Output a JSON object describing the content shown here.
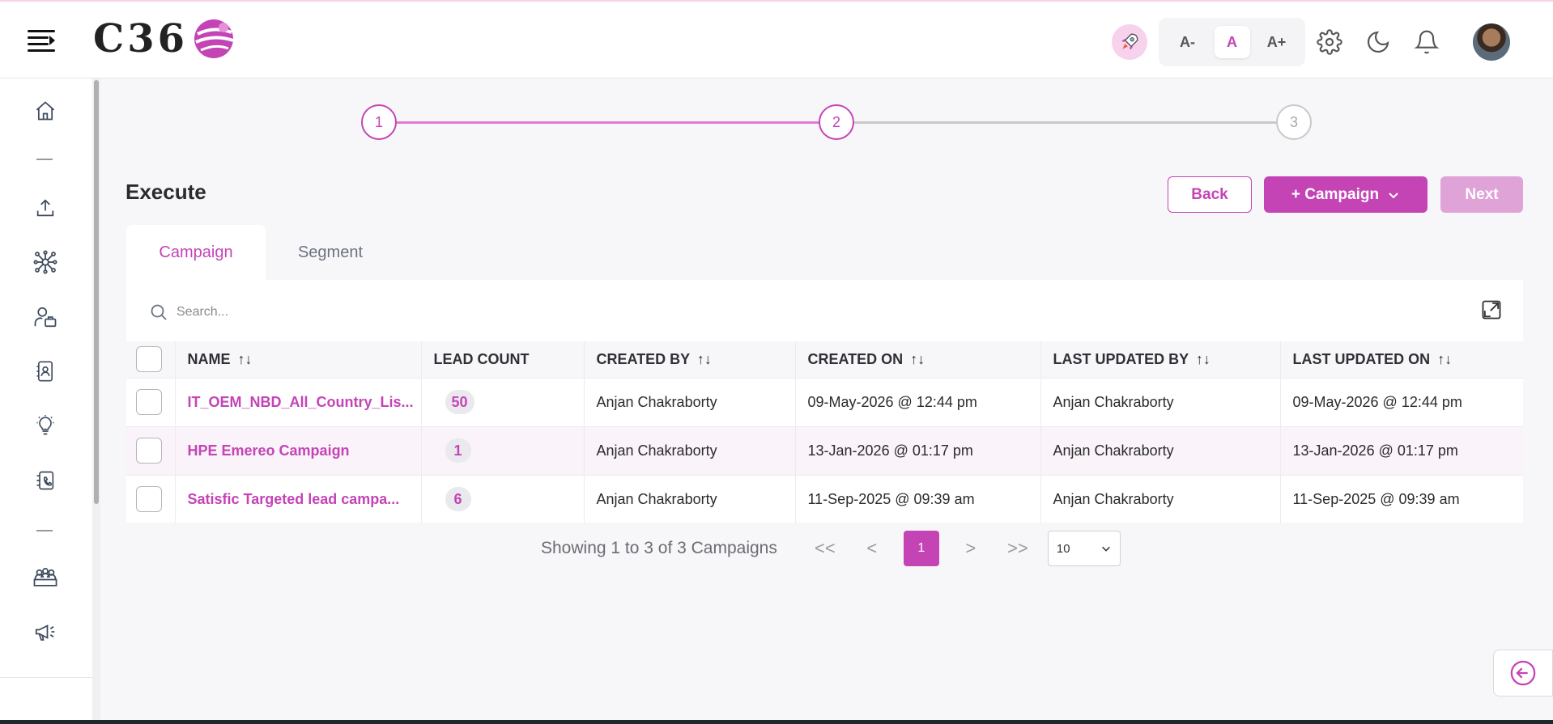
{
  "header": {
    "logo_text": "C36",
    "font_controls": {
      "decrease": "A-",
      "normal": "A",
      "increase": "A+"
    }
  },
  "stepper": {
    "steps": [
      "1",
      "2",
      "3"
    ]
  },
  "page": {
    "title": "Execute",
    "back_label": "Back",
    "campaign_label": "+ Campaign",
    "next_label": "Next"
  },
  "tabs": [
    {
      "label": "Campaign"
    },
    {
      "label": "Segment"
    }
  ],
  "search": {
    "placeholder": "Search..."
  },
  "table": {
    "columns": [
      "NAME",
      "LEAD COUNT",
      "CREATED BY",
      "CREATED ON",
      "LAST UPDATED BY",
      "LAST UPDATED ON"
    ],
    "sort_glyph": "↑↓",
    "rows": [
      {
        "name": "IT_OEM_NBD_All_Country_Lis...",
        "lead_count": "50",
        "created_by": "Anjan Chakraborty",
        "created_on": "09-May-2026 @ 12:44 pm",
        "updated_by": "Anjan Chakraborty",
        "updated_on": "09-May-2026 @ 12:44 pm"
      },
      {
        "name": "HPE Emereo Campaign",
        "lead_count": "1",
        "created_by": "Anjan Chakraborty",
        "created_on": "13-Jan-2026 @ 01:17 pm",
        "updated_by": "Anjan Chakraborty",
        "updated_on": "13-Jan-2026 @ 01:17 pm"
      },
      {
        "name": "Satisfic Targeted lead campa...",
        "lead_count": "6",
        "created_by": "Anjan Chakraborty",
        "created_on": "11-Sep-2025 @ 09:39 am",
        "updated_by": "Anjan Chakraborty",
        "updated_on": "11-Sep-2025 @ 09:39 am"
      }
    ]
  },
  "pagination": {
    "summary": "Showing 1 to 3 of 3 Campaigns",
    "first": "<<",
    "prev": "<",
    "current_page": "1",
    "next": ">",
    "last": ">>",
    "page_size": "10"
  },
  "colors": {
    "accent": "#c444b6",
    "accent_light": "#e0a3d8"
  }
}
